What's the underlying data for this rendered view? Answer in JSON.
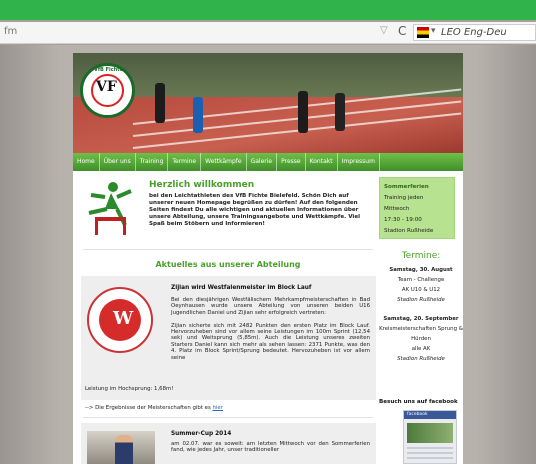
{
  "browser": {
    "url_text": "fm",
    "search_placeholder": "LEO Eng-Deu"
  },
  "nav": [
    "Home",
    "Über uns",
    "Training",
    "Termine",
    "Wettkämpfe",
    "Galerie",
    "Presse",
    "Kontakt",
    "Impressum"
  ],
  "welcome": {
    "title": "Herzlich willkommen",
    "text": "bei den Leichtathleten des VfB Fichte Bielefeld. Schön Dich auf unserer neuen Homepage begrüßen zu dürfen! Auf den folgenden Seiten findest Du alle wichtigen und aktuellen Informationen über unsere Abteilung, unsere Trainingsangebote und Wettkämpfe. Viel Spaß beim Stöbern und Informieren!"
  },
  "summer_box": {
    "title": "Sommerferien",
    "line1": "Training jeden Mittwoch",
    "line2": "17:30 - 19:00",
    "line3": "Stadion Rußheide"
  },
  "news_heading": "Aktuelles aus unserer Abteilung",
  "article1": {
    "title": "Zijian wird Westfalenmeister im Block Lauf",
    "text": "Bei den diesjährigen Westfälischem Mehrkampfmeisterschaften in Bad Oeynhausen wurde unsere Abteilung von unseren beiden U16 Jugendlichen Daniel und Zijian sehr erfolgreich vertreten:",
    "text2": "Zijian sicherte sich mit 2482 Punkten den ersten Platz im Block Lauf. Hervorzuheben sind vor allem seine Leistungen im 100m Sprint (12,54 sek) und Weitsprung (5,85m). Auch die Leistung unseres zweiten Starters Daniel kann sich mehr als sehen lassen: 2371 Punkte, was den 4. Platz im Block Sprint/Sprung bedeutet. Hervozuheben ist vor allem seine",
    "text3": "Leistung im Hochsprung: 1,68m!",
    "link_prefix": "--> Die Ergebnisse der Meisterschaften gibt es",
    "link_text": "hier"
  },
  "article2": {
    "title": "Summer-Cup 2014",
    "text": "am 02.07. war es soweit: am letzten Mittwoch vor den Sommerferien fand, wie jedes Jahr, unser traditioneller"
  },
  "termine": {
    "title": "Termine:",
    "items": [
      {
        "date": "Samstag, 30. August",
        "name": "Team - Challenge",
        "group": "AK U10 & U12",
        "place": "Stadion Rußheide"
      },
      {
        "date": "Samstag, 20. September",
        "name": "Kreismeisterschaften Sprung & Hürden",
        "group": "alle AK",
        "place": "Stadion Rußheide"
      }
    ]
  },
  "facebook": {
    "title": "Besuch uns auf facebook",
    "label": "facebook"
  },
  "colors": {
    "brand_green": "#4aa02c",
    "browser_green": "#2fb34a",
    "summer_box": "#b7e28f"
  }
}
